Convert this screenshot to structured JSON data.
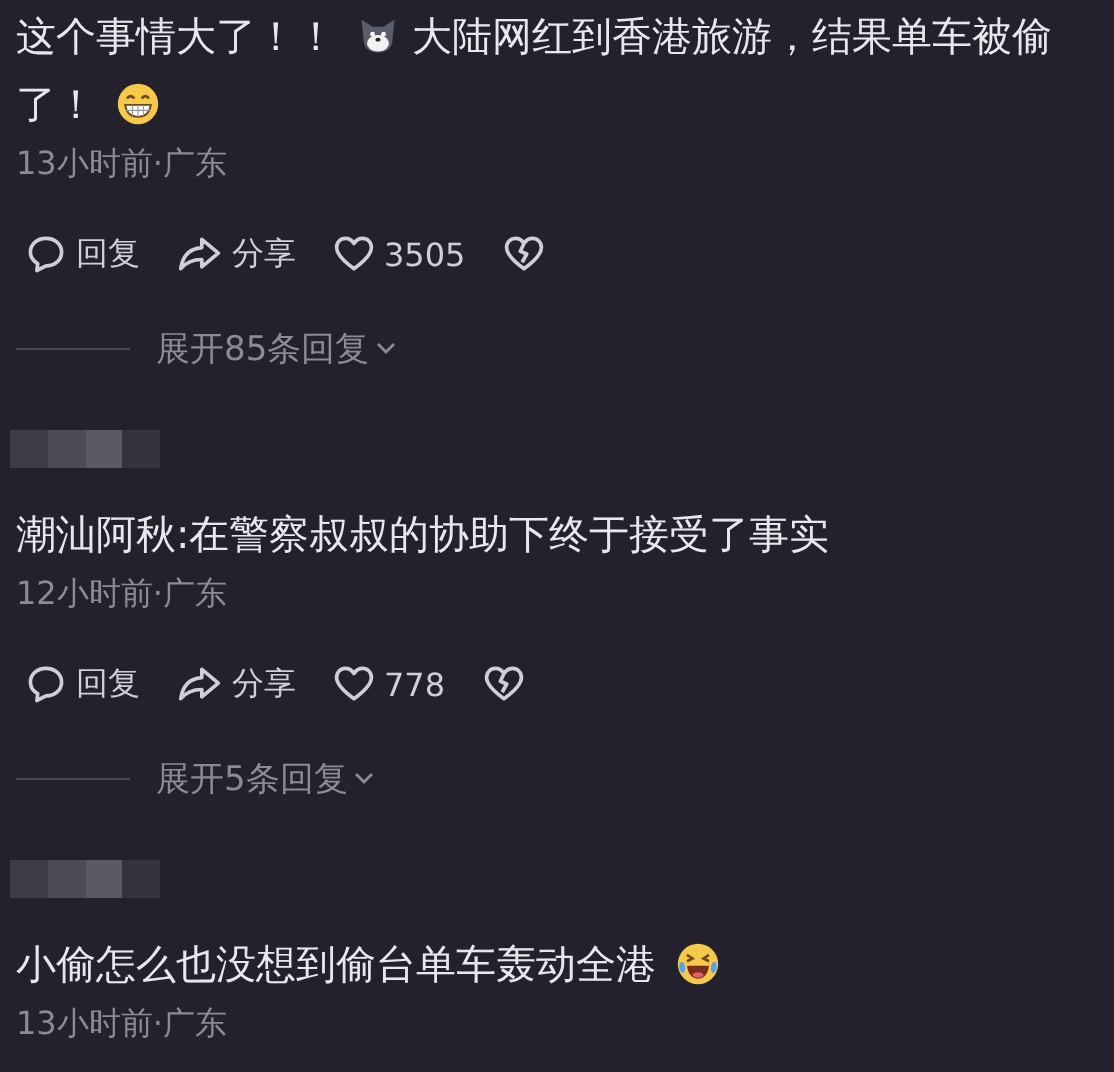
{
  "comments": [
    {
      "username_hidden": false,
      "content": [
        {
          "kind": "text",
          "text": "这个事情大了！！"
        },
        {
          "kind": "cat"
        },
        {
          "kind": "text",
          "text": "大陆网红到香港旅游，结果单车被偷"
        },
        {
          "kind": "text",
          "text": "了！"
        },
        {
          "kind": "grin"
        }
      ],
      "meta": "13小时前·广东",
      "actions": {
        "reply": "回复",
        "share": "分享",
        "likes": "3505"
      },
      "expand": "展开85条回复"
    },
    {
      "username_hidden": true,
      "content": [
        {
          "kind": "text",
          "text": "潮汕阿秋:在警察叔叔的协助下终于接受了事实"
        }
      ],
      "meta": "12小时前·广东",
      "actions": {
        "reply": "回复",
        "share": "分享",
        "likes": "778"
      },
      "expand": "展开5条回复"
    },
    {
      "username_hidden": true,
      "content": [
        {
          "kind": "text",
          "text": "小偷怎么也没想到偷台单车轰动全港"
        },
        {
          "kind": "laugh"
        }
      ],
      "meta": "13小时前·广东"
    }
  ]
}
